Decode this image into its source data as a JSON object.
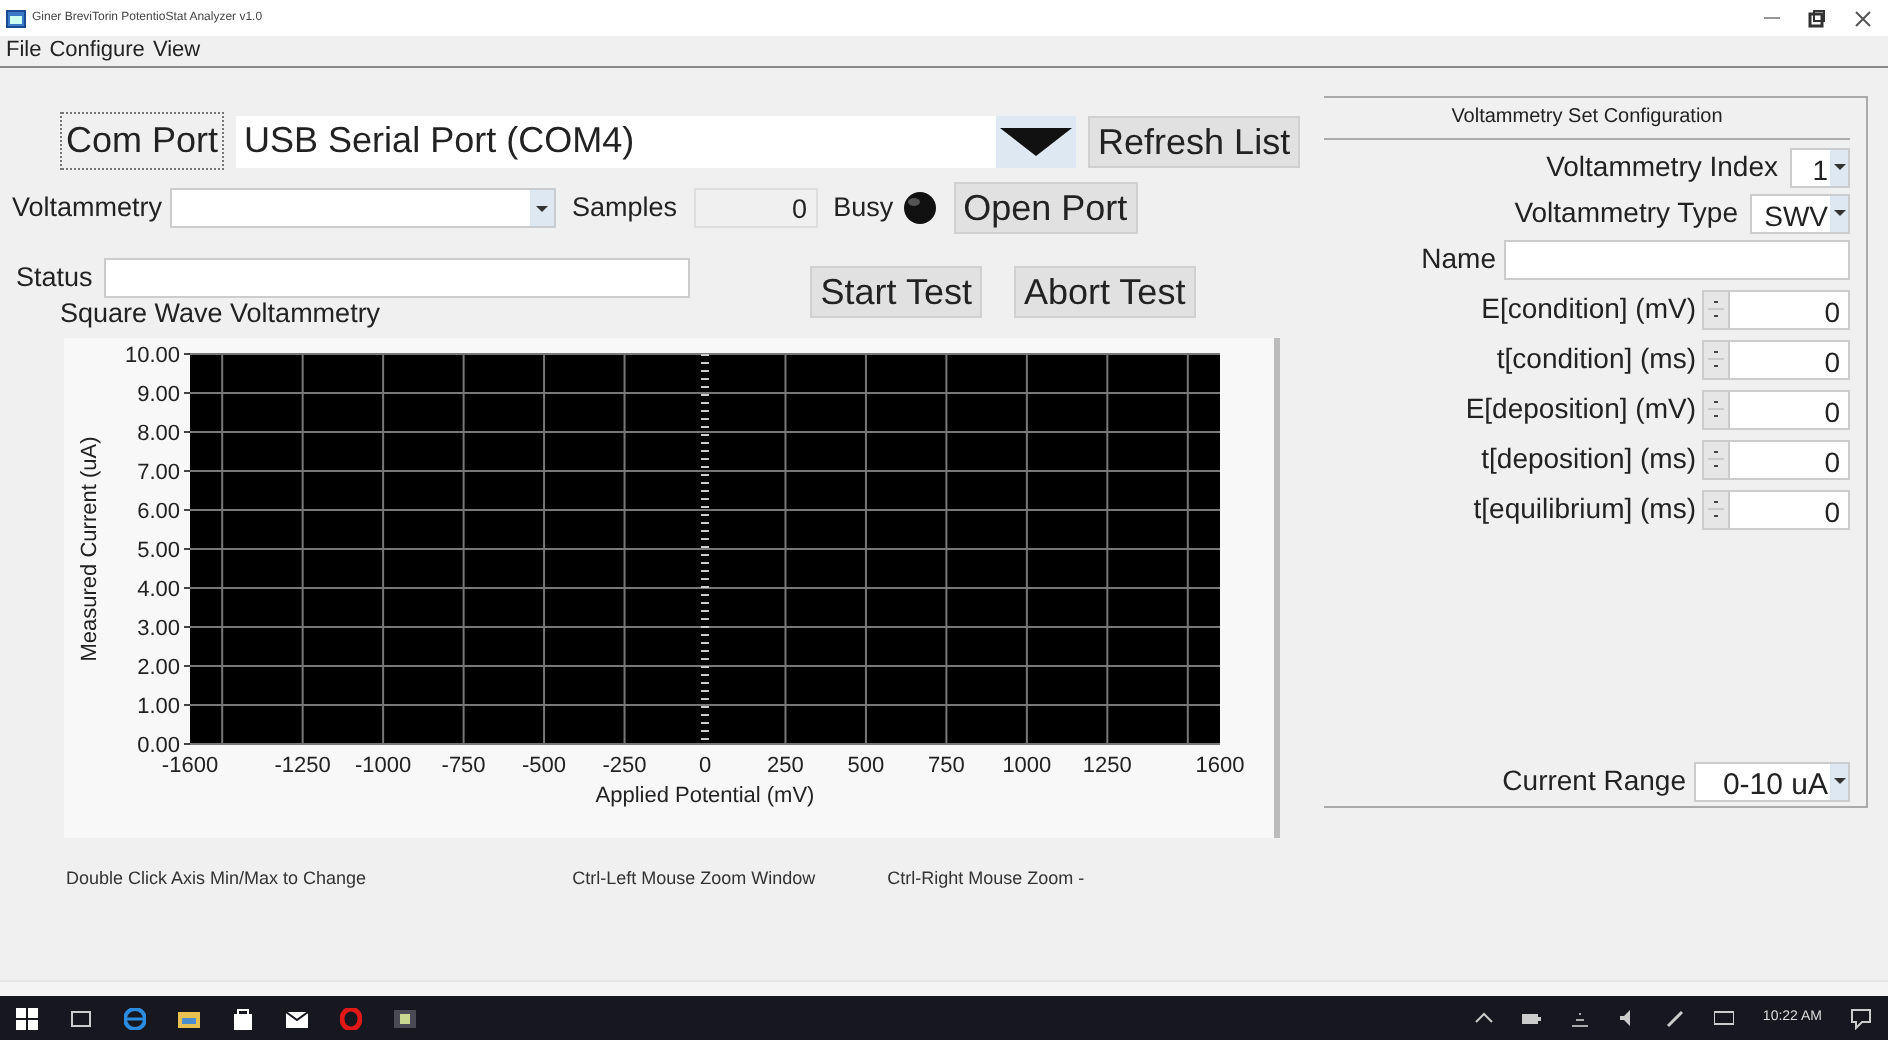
{
  "window": {
    "title": "Giner BreviTorin PotentioStat Analyzer v1.0"
  },
  "menu": [
    "File",
    "Configure",
    "View"
  ],
  "com_port": {
    "label": "Com Port",
    "value": "USB Serial Port (COM4)"
  },
  "refresh_button": "Refresh List",
  "voltammetry": {
    "label": "Voltammetry"
  },
  "samples": {
    "label": "Samples",
    "value": "0"
  },
  "busy": {
    "label": "Busy",
    "on": false
  },
  "open_button": "Open Port",
  "status": {
    "label": "Status"
  },
  "start_button": "Start Test",
  "abort_button": "Abort Test",
  "chart": {
    "title": "Square Wave Voltammetry",
    "chart_data": {
      "type": "line",
      "xlabel": "Applied Potential (mV)",
      "ylabel": "Measured Current (uA)",
      "xlim": [
        -1600,
        1600
      ],
      "ylim": [
        0,
        10
      ],
      "grid": true,
      "ref_lines": [
        {
          "axis": "x",
          "value": 0
        }
      ],
      "xticks": [
        -1600,
        -1250,
        -1000,
        -750,
        -500,
        -250,
        0,
        250,
        500,
        750,
        1000,
        1250,
        1600
      ],
      "yticks": [
        {
          "value": 0,
          "label": "0.00"
        },
        {
          "value": 1,
          "label": "1.00"
        },
        {
          "value": 2,
          "label": "2.00"
        },
        {
          "value": 3,
          "label": "3.00"
        },
        {
          "value": 4,
          "label": "4.00"
        },
        {
          "value": 5,
          "label": "5.00"
        },
        {
          "value": 6,
          "label": "6.00"
        },
        {
          "value": 7,
          "label": "7.00"
        },
        {
          "value": 8,
          "label": "8.00"
        },
        {
          "value": 9,
          "label": "9.00"
        },
        {
          "value": 10,
          "label": "10.00"
        }
      ]
    }
  },
  "hints": [
    "Double Click Axis Min/Max to Change",
    "Ctrl-Left Mouse Zoom Window",
    "Ctrl-Right Mouse Zoom -"
  ],
  "config": {
    "title": "Voltammetry Set Configuration",
    "index": {
      "label": "Voltammetry Index",
      "value": "1"
    },
    "type": {
      "label": "Voltammetry Type",
      "value": "SWV"
    },
    "name": {
      "label": "Name"
    },
    "params": [
      {
        "label": "E[condition] (mV)",
        "value": "0"
      },
      {
        "label": "t[condition] (ms)",
        "value": "0"
      },
      {
        "label": "E[deposition] (mV)",
        "value": "0"
      },
      {
        "label": "t[deposition] (ms)",
        "value": "0"
      },
      {
        "label": "t[equilibrium] (ms)",
        "value": "0"
      }
    ],
    "current_range": {
      "label": "Current Range",
      "value": "0-10 uA"
    }
  },
  "taskbar": {
    "clock": "10:22 AM"
  }
}
